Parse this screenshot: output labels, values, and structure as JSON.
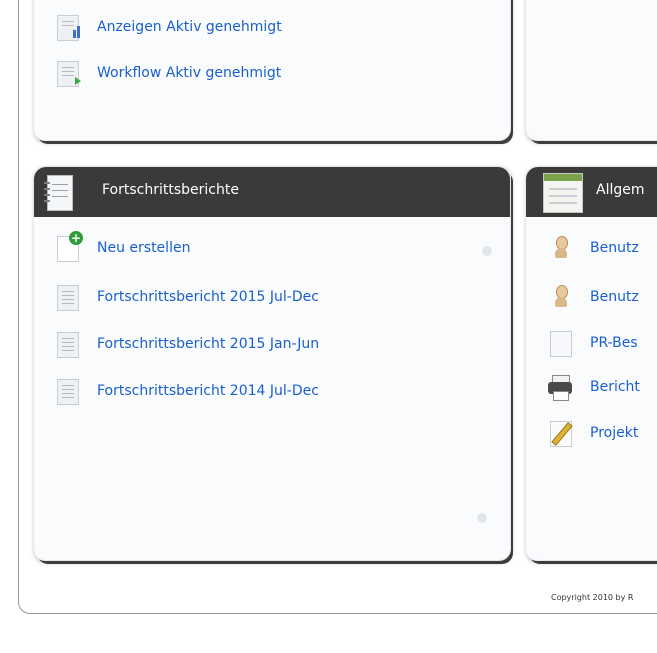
{
  "top_panel": {
    "items": [
      {
        "label": "Anzeigen Aktiv genehmigt",
        "icon": "chart-document-icon"
      },
      {
        "label": "Workflow Aktiv genehmigt",
        "icon": "workflow-document-icon"
      }
    ]
  },
  "progress_reports": {
    "header": "Fortschrittsberichte",
    "items": [
      {
        "label": "Neu erstellen",
        "icon": "new-document-icon"
      },
      {
        "label": "Fortschrittsbericht 2015 Jul-Dec",
        "icon": "document-icon"
      },
      {
        "label": "Fortschrittsbericht 2015 Jan-Jun",
        "icon": "document-icon"
      },
      {
        "label": "Fortschrittsbericht 2014 Jul-Dec",
        "icon": "document-icon"
      }
    ]
  },
  "general": {
    "header": "Allgem",
    "items": [
      {
        "label": "Benutz",
        "icon": "user-icon"
      },
      {
        "label": "Benutz",
        "icon": "user-icon"
      },
      {
        "label": "PR-Bes",
        "icon": "document-icon"
      },
      {
        "label": "Bericht",
        "icon": "printer-icon"
      },
      {
        "label": "Projekt",
        "icon": "pencil-icon"
      }
    ]
  },
  "footer": {
    "copyright": "Copyright 2010 by R"
  },
  "colors": {
    "link": "#1a5fcc",
    "header_bg": "#3a3a3a",
    "header_text": "#ffffff"
  }
}
